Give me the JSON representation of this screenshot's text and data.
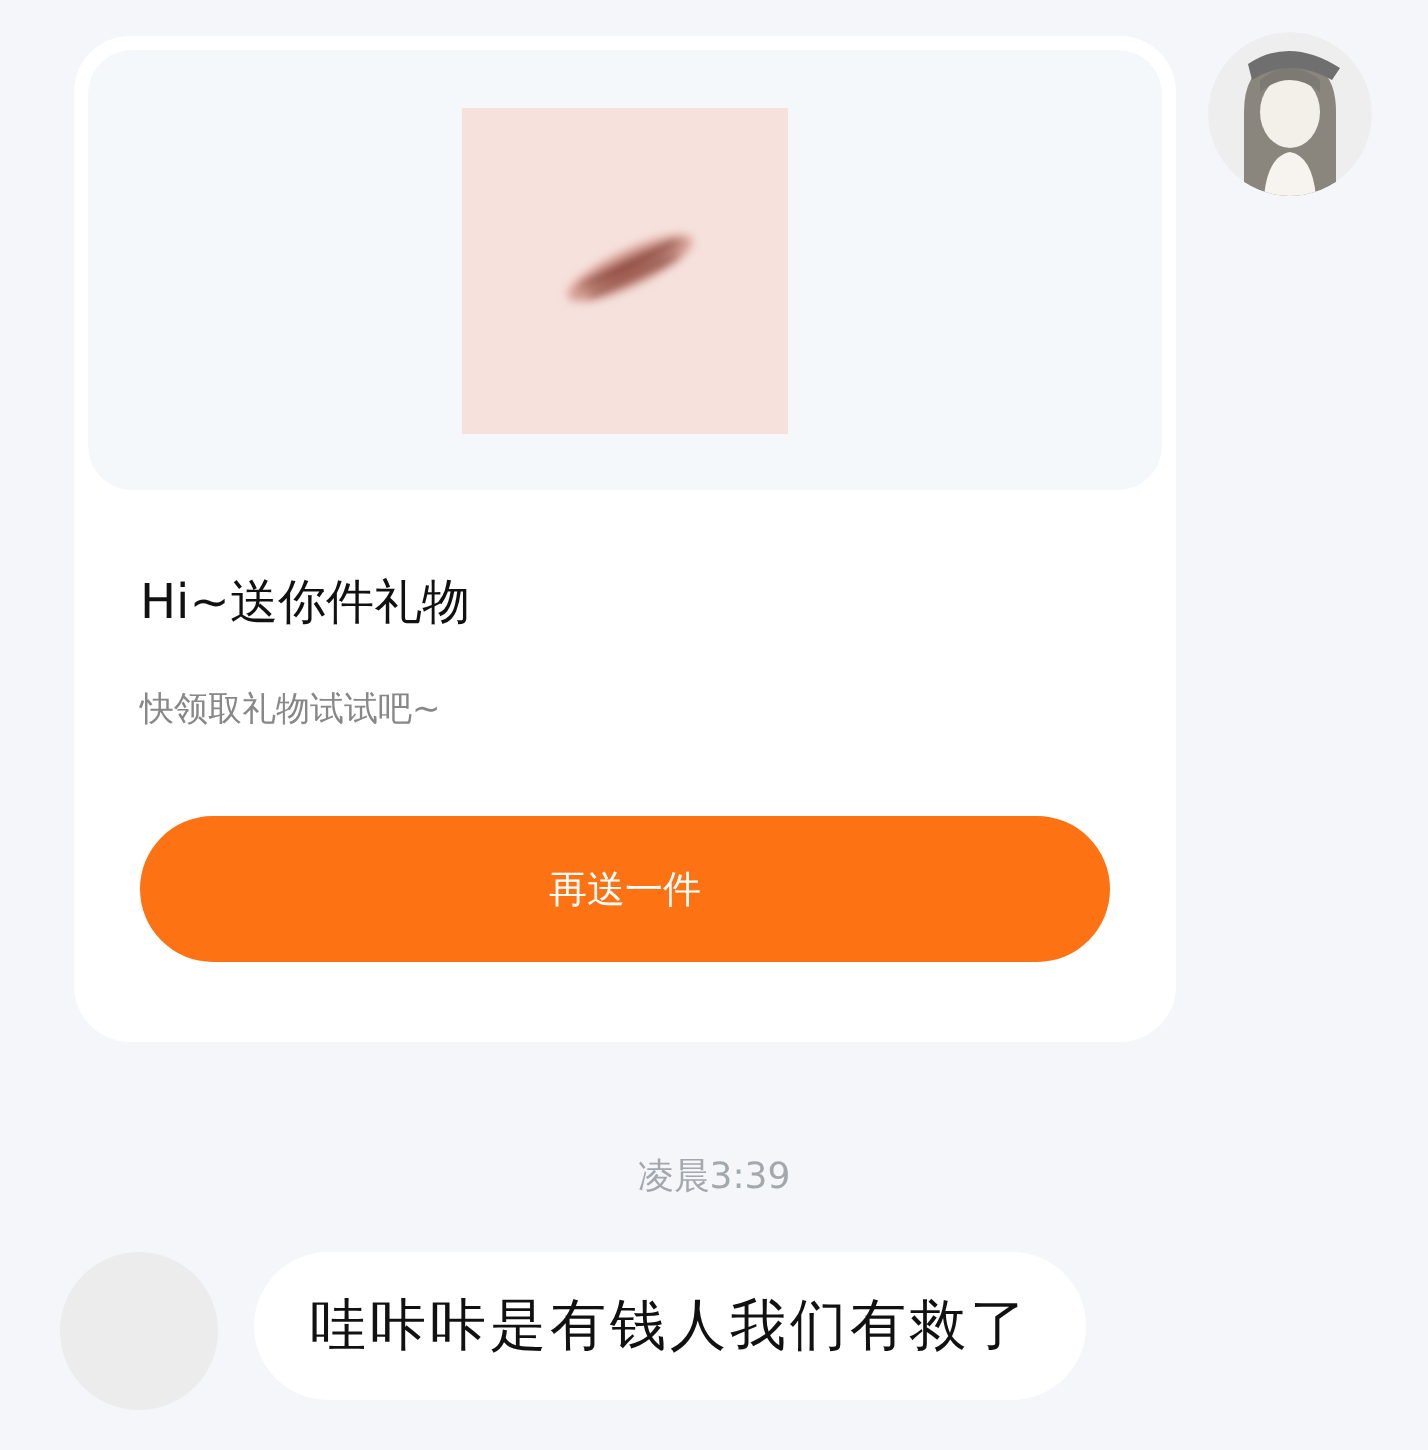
{
  "messages": [
    {
      "kind": "gift",
      "outgoing": true,
      "title": "Hi~送你件礼物",
      "subtitle": "快领取礼物试试吧~",
      "button": "再送一件"
    },
    {
      "kind": "time",
      "text": "凌晨3:39"
    },
    {
      "kind": "text",
      "outgoing": false,
      "text": "哇咔咔是有钱人我们有救了"
    }
  ]
}
